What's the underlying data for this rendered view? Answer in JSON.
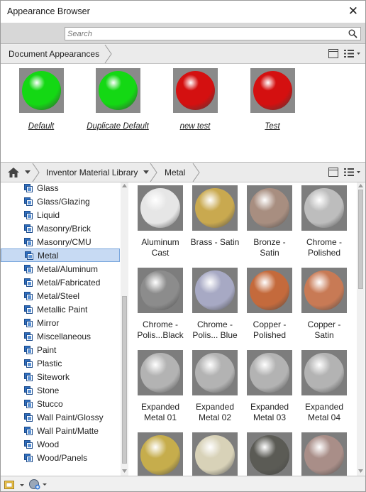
{
  "window": {
    "title": "Appearance Browser"
  },
  "search": {
    "placeholder": "Search"
  },
  "document": {
    "header": "Document Appearances",
    "items": [
      {
        "label": "Default",
        "color": "#14d814"
      },
      {
        "label": "Duplicate Default",
        "color": "#14d814"
      },
      {
        "label": "new test",
        "color": "#d41010"
      },
      {
        "label": "Test",
        "color": "#d41010"
      }
    ]
  },
  "library": {
    "breadcrumb": [
      "Inventor Material Library",
      "Metal"
    ],
    "categories": [
      "Glass",
      "Glass/Glazing",
      "Liquid",
      "Masonry/Brick",
      "Masonry/CMU",
      "Metal",
      "Metal/Aluminum",
      "Metal/Fabricated",
      "Metal/Steel",
      "Metallic Paint",
      "Mirror",
      "Miscellaneous",
      "Paint",
      "Plastic",
      "Sitework",
      "Stone",
      "Stucco",
      "Wall Paint/Glossy",
      "Wall Paint/Matte",
      "Wood",
      "Wood/Panels"
    ],
    "selected_category": "Metal",
    "materials": [
      {
        "label": "Aluminum Cast",
        "base": "#e6e6e6",
        "bg": "#7d7d7d"
      },
      {
        "label": "Brass - Satin",
        "base": "#c9a94f",
        "bg": "#7d7d7d"
      },
      {
        "label": "Bronze - Satin",
        "base": "#a88e80",
        "bg": "#7d7d7d"
      },
      {
        "label": "Chrome - Polished",
        "base": "#bdbdbd",
        "bg": "#7d7d7d"
      },
      {
        "label": "Chrome - Polis...Black",
        "base": "#8c8c8c",
        "bg": "#7d7d7d"
      },
      {
        "label": "Chrome - Polis... Blue",
        "base": "#a7a9c4",
        "bg": "#7d7d7d"
      },
      {
        "label": "Copper - Polished",
        "base": "#c46a3c",
        "bg": "#7d7d7d"
      },
      {
        "label": "Copper - Satin",
        "base": "#c87a55",
        "bg": "#7d7d7d"
      },
      {
        "label": "Expanded Metal 01",
        "base": "#b3b3b3",
        "bg": "#7d7d7d"
      },
      {
        "label": "Expanded Metal 02",
        "base": "#b3b3b3",
        "bg": "#7d7d7d"
      },
      {
        "label": "Expanded Metal 03",
        "base": "#b3b3b3",
        "bg": "#7d7d7d"
      },
      {
        "label": "Expanded Metal 04",
        "base": "#b3b3b3",
        "bg": "#7d7d7d"
      },
      {
        "label": "",
        "base": "#c6ad4c",
        "bg": "#7d7d7d"
      },
      {
        "label": "",
        "base": "#d8d2b8",
        "bg": "#7d7d7d"
      },
      {
        "label": "",
        "base": "#5b5b55",
        "bg": "#7d7d7d"
      },
      {
        "label": "",
        "base": "#a98e88",
        "bg": "#7d7d7d"
      }
    ]
  }
}
